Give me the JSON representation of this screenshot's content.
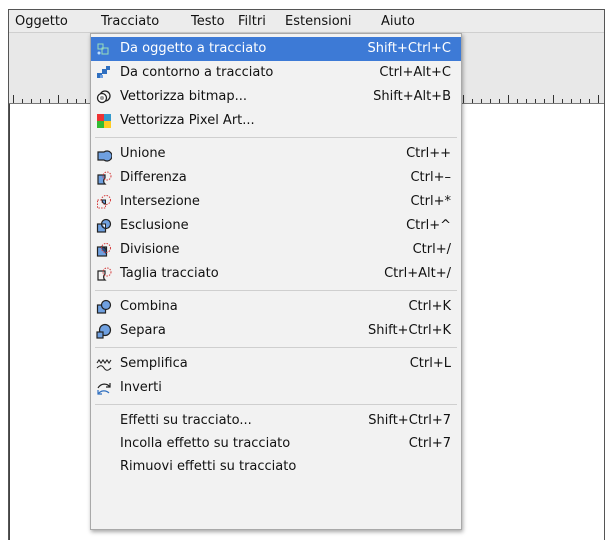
{
  "menubar": {
    "items": [
      {
        "label": "Oggetto"
      },
      {
        "label": "Tracciato"
      },
      {
        "label": "Testo"
      },
      {
        "label": "Filtri"
      },
      {
        "label": "Estensioni"
      },
      {
        "label": "Aiuto"
      }
    ]
  },
  "menu": {
    "groups": [
      [
        {
          "label": "Da oggetto a tracciato",
          "shortcut": "Shift+Ctrl+C",
          "icon": "object-to-path-icon"
        },
        {
          "label": "Da contorno a tracciato",
          "shortcut": "Ctrl+Alt+C",
          "icon": "stroke-to-path-icon"
        },
        {
          "label": "Vettorizza bitmap...",
          "shortcut": "Shift+Alt+B",
          "icon": "trace-bitmap-icon"
        },
        {
          "label": "Vettorizza Pixel Art...",
          "shortcut": "",
          "icon": "trace-pixel-art-icon"
        }
      ],
      [
        {
          "label": "Unione",
          "shortcut": "Ctrl++",
          "icon": "union-icon"
        },
        {
          "label": "Differenza",
          "shortcut": "Ctrl+–",
          "icon": "difference-icon"
        },
        {
          "label": "Intersezione",
          "shortcut": "Ctrl+*",
          "icon": "intersection-icon"
        },
        {
          "label": "Esclusione",
          "shortcut": "Ctrl+^",
          "icon": "exclusion-icon"
        },
        {
          "label": "Divisione",
          "shortcut": "Ctrl+/",
          "icon": "division-icon"
        },
        {
          "label": "Taglia tracciato",
          "shortcut": "Ctrl+Alt+/",
          "icon": "cut-path-icon"
        }
      ],
      [
        {
          "label": "Combina",
          "shortcut": "Ctrl+K",
          "icon": "combine-icon"
        },
        {
          "label": "Separa",
          "shortcut": "Shift+Ctrl+K",
          "icon": "break-apart-icon"
        }
      ],
      [
        {
          "label": "Semplifica",
          "shortcut": "Ctrl+L",
          "icon": "simplify-icon"
        },
        {
          "label": "Inverti",
          "shortcut": "",
          "icon": "reverse-icon"
        }
      ],
      [
        {
          "label": "Effetti su tracciato...",
          "shortcut": "Shift+Ctrl+7",
          "icon": ""
        },
        {
          "label": "Incolla effetto su tracciato",
          "shortcut": "Ctrl+7",
          "icon": ""
        },
        {
          "label": "Rimuovi effetti su tracciato",
          "shortcut": "",
          "icon": ""
        }
      ]
    ]
  },
  "colors": {
    "highlight": "#3d7ad6",
    "menu_bg": "#f2f2f2",
    "bar_bg": "#ececec"
  }
}
